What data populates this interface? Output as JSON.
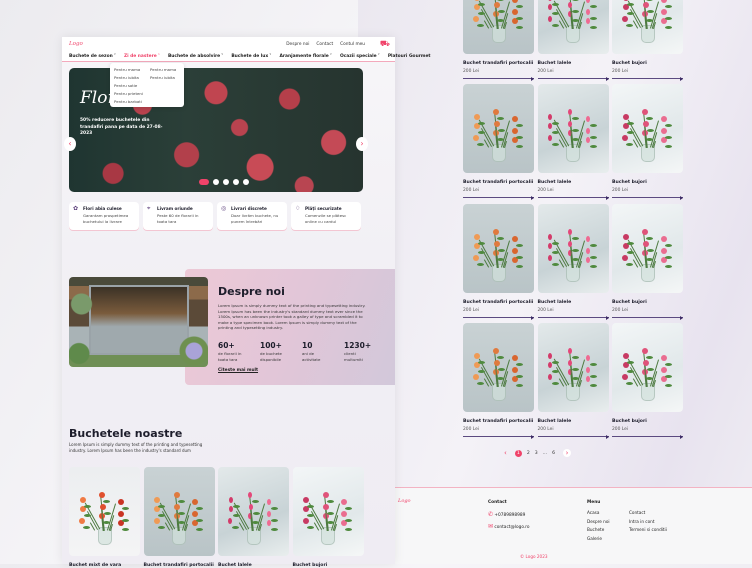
{
  "colors": {
    "accent": "#f0436a",
    "purple": "#3c2b65"
  },
  "header": {
    "logo": "Logo",
    "top_links": [
      "Despre noi",
      "Contact",
      "Contul meu"
    ],
    "cart_icon": "cart-icon"
  },
  "nav": {
    "items": [
      "Buchete de sezon",
      "Zi de nastere",
      "Buchete de absolvire",
      "Buchete de lux",
      "Aranjamente florale",
      "Ocazii speciale",
      "Platouri Gourmet"
    ],
    "dropdown": {
      "col1": [
        "Pentru mama",
        "Pentru iubita",
        "Pentru sotie",
        "Pentru prieteni",
        "Pentru barbati"
      ],
      "col2": [
        "Pentru mama",
        "Pentru iubita"
      ]
    }
  },
  "hero": {
    "title": "Flori",
    "subtitle": "50% reducere buchetele din trandafiri pana pe data de 27-08-2023",
    "slides": 5,
    "active_slide": 1
  },
  "features": [
    {
      "title": "Flori abia culese",
      "desc": "Garantam prospetimea buchetului la livrare"
    },
    {
      "title": "Livram oriunde",
      "desc": "Peste 60 de florarii in toata tara"
    },
    {
      "title": "Livrari discrete",
      "desc": "Doar livrăm buchete, nu punem întrebări"
    },
    {
      "title": "Plăți securizate",
      "desc": "Comenzile se plătesc online cu cardul"
    }
  ],
  "about": {
    "title": "Despre noi",
    "text": "Lorem Ipsum is simply dummy text of the printing and typesetting industry. Lorem Ipsum has been the industry's standard dummy text ever since the 1500s, when an unknown printer took a galley of type and scrambled it to make a type specimen book. Lorem Ipsum is simply dummy text of the printing and typesetting industry.",
    "stats": [
      {
        "n": "60+",
        "l": "de florarii in toata tara"
      },
      {
        "n": "100+",
        "l": "de buchete disponibile"
      },
      {
        "n": "10",
        "l": "ani de activitate"
      },
      {
        "n": "1230+",
        "l": "clienti multumiti"
      }
    ],
    "link": "Citeste mai mult"
  },
  "bouquets": {
    "title": "Buchetele noastre",
    "desc": "Lorem Ipsum is simply dummy text of the printing and typesetting industry. Lorem Ipsum has been the industry's standard dum",
    "items": [
      {
        "name": "Buchet mixt de vara",
        "kind": "mix"
      },
      {
        "name": "Buchet trandafiri portocalii",
        "kind": "orange"
      },
      {
        "name": "Buchet lalele",
        "kind": "tulip"
      },
      {
        "name": "Buchet bujori",
        "kind": "peony"
      }
    ]
  },
  "catalog": {
    "rows": [
      [
        {
          "name": "Buchet trandafiri portocalii",
          "price": "200 Lei",
          "kind": "orange"
        },
        {
          "name": "Buchet lalele",
          "price": "200 Lei",
          "kind": "tulip"
        },
        {
          "name": "Buchet bujori",
          "price": "200 Lei",
          "kind": "peony"
        }
      ],
      [
        {
          "name": "Buchet trandafiri portocalii",
          "price": "200 Lei",
          "kind": "orange"
        },
        {
          "name": "Buchet lalele",
          "price": "200 Lei",
          "kind": "tulip"
        },
        {
          "name": "Buchet bujori",
          "price": "200 Lei",
          "kind": "peony"
        }
      ],
      [
        {
          "name": "Buchet trandafiri portocalii",
          "price": "200 Lei",
          "kind": "orange"
        },
        {
          "name": "Buchet lalele",
          "price": "200 Lei",
          "kind": "tulip"
        },
        {
          "name": "Buchet bujori",
          "price": "200 Lei",
          "kind": "peony"
        }
      ],
      [
        {
          "name": "Buchet trandafiri portocalii",
          "price": "200 Lei",
          "kind": "orange"
        },
        {
          "name": "Buchet lalele",
          "price": "200 Lei",
          "kind": "tulip"
        },
        {
          "name": "Buchet bujori",
          "price": "200 Lei",
          "kind": "peony"
        }
      ]
    ]
  },
  "pagination": {
    "pages": [
      "1",
      "2",
      "3",
      "...",
      "6"
    ],
    "current": "1",
    "prev": "‹",
    "next": "›"
  },
  "footer": {
    "logo": "Logo",
    "contact_title": "Contact",
    "phone": "+0789898989",
    "email": "contact@logo.ro",
    "menu_title": "Menu",
    "menu_col1": [
      "Acasa",
      "Despre noi",
      "Buchete",
      "Galerie"
    ],
    "menu_col2": [
      "Contact",
      "Intra in cont",
      "Termeni si conditii"
    ],
    "copyright": "© Logo 2023"
  }
}
